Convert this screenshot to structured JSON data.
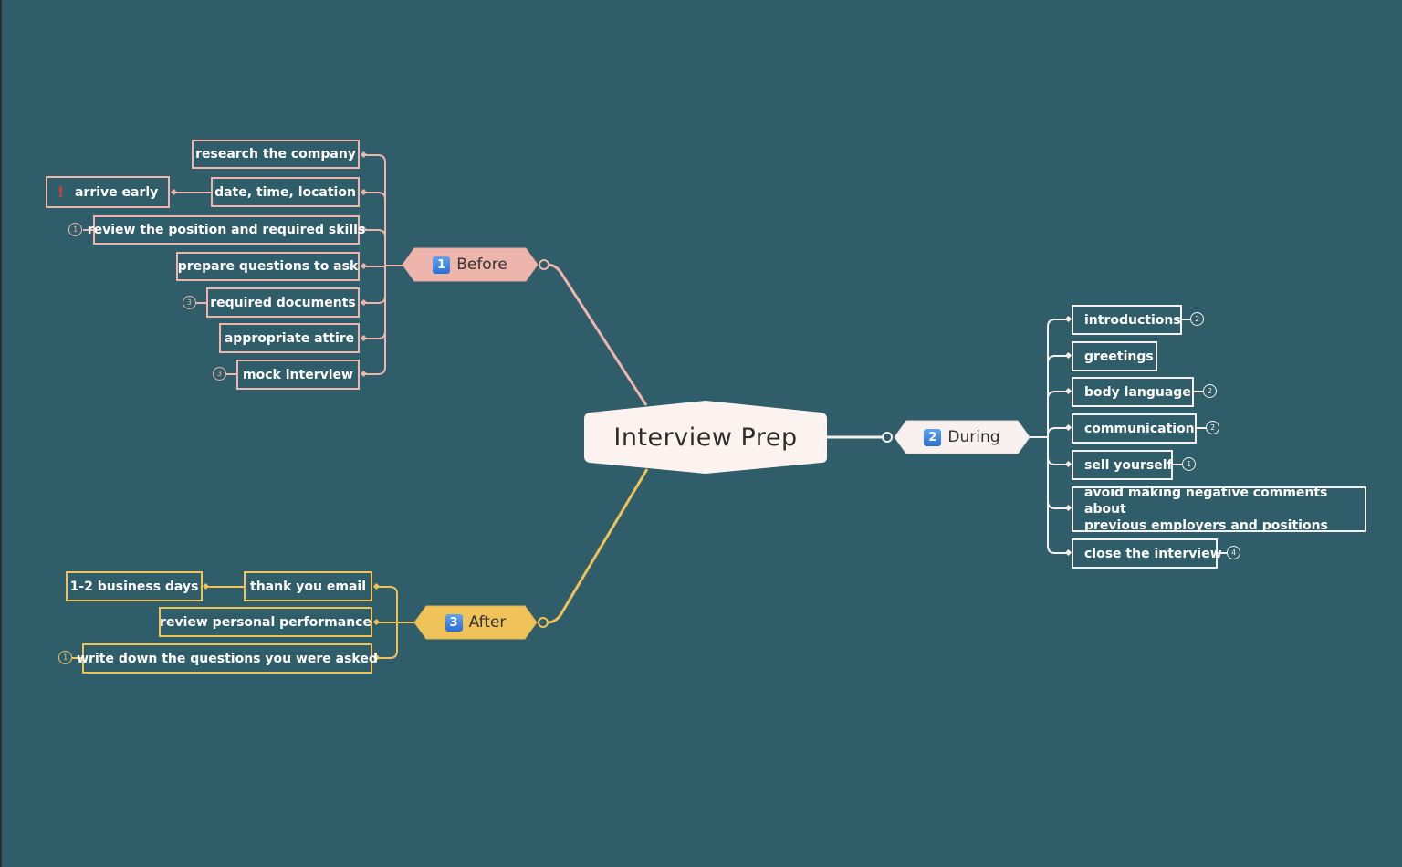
{
  "central_topic": "Interview Prep",
  "colors": {
    "background": "#2f5d69",
    "before": "#eeb5ad",
    "during": "#f5f0ee",
    "after": "#efc35a",
    "central_fill": "#fcf3f1",
    "number_key": "#3b82e0",
    "priority_mark": "#e03b2f"
  },
  "branches": {
    "before": {
      "number": "1",
      "label": "Before",
      "children": [
        {
          "label": "research the company"
        },
        {
          "label": "date, time, location",
          "child": {
            "label": "arrive early",
            "icon": "priority-exclamation-icon",
            "icon_glyph": "!"
          }
        },
        {
          "label": "review the position and required skills",
          "count": "1"
        },
        {
          "label": "prepare questions to ask"
        },
        {
          "label": "required documents",
          "count": "3"
        },
        {
          "label": "appropriate attire"
        },
        {
          "label": "mock interview",
          "count": "3"
        }
      ]
    },
    "during": {
      "number": "2",
      "label": "During",
      "children": [
        {
          "label": "introductions",
          "count": "2"
        },
        {
          "label": "greetings"
        },
        {
          "label": "body language",
          "count": "2"
        },
        {
          "label": "communication",
          "count": "2"
        },
        {
          "label": "sell yourself",
          "count": "1"
        },
        {
          "label_line1": "avoid making negative comments about",
          "label_line2": "previous employers and positions"
        },
        {
          "label": "close the interview",
          "count": "4"
        }
      ]
    },
    "after": {
      "number": "3",
      "label": "After",
      "children": [
        {
          "label": "thank you email",
          "child": {
            "label": "1-2 business days"
          }
        },
        {
          "label": "review personal performance"
        },
        {
          "label": "write down the questions you were asked",
          "count": "1"
        }
      ]
    }
  }
}
